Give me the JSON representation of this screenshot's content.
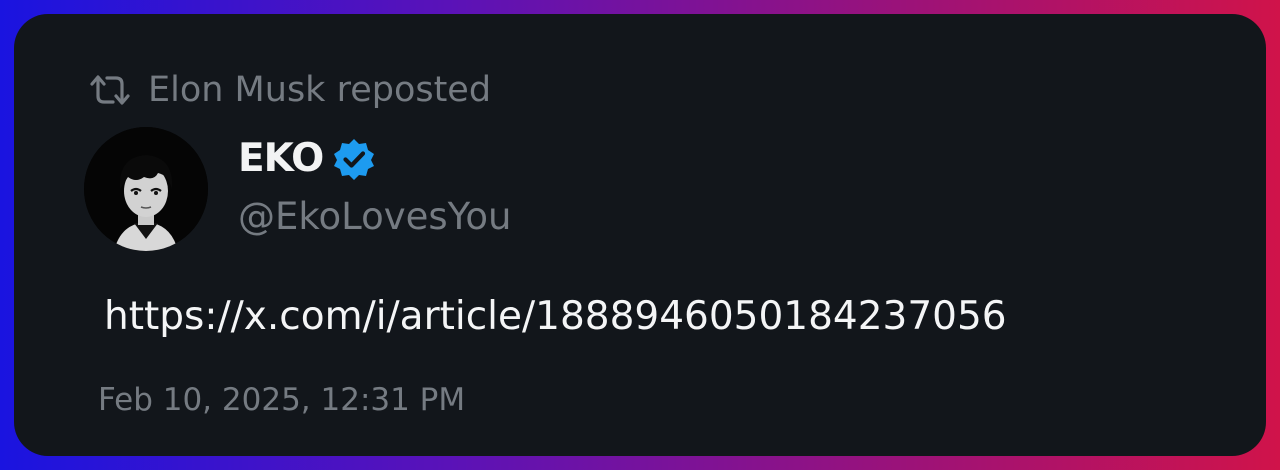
{
  "repost": {
    "icon": "repost-icon",
    "text": "Elon Musk reposted"
  },
  "author": {
    "display_name": "EKO",
    "handle": "@EkoLovesYou",
    "verified": true,
    "verified_color": "#1d9bf0",
    "avatar_icon": "avatar-anime-portrait"
  },
  "post": {
    "text": "https://x.com/i/article/1888946050184237056"
  },
  "meta": {
    "timestamp": "Feb 10, 2025, 12:31 PM"
  },
  "colors": {
    "card_background": "#12161b",
    "muted_text": "#757b82",
    "primary_text": "#f4f5f6"
  }
}
